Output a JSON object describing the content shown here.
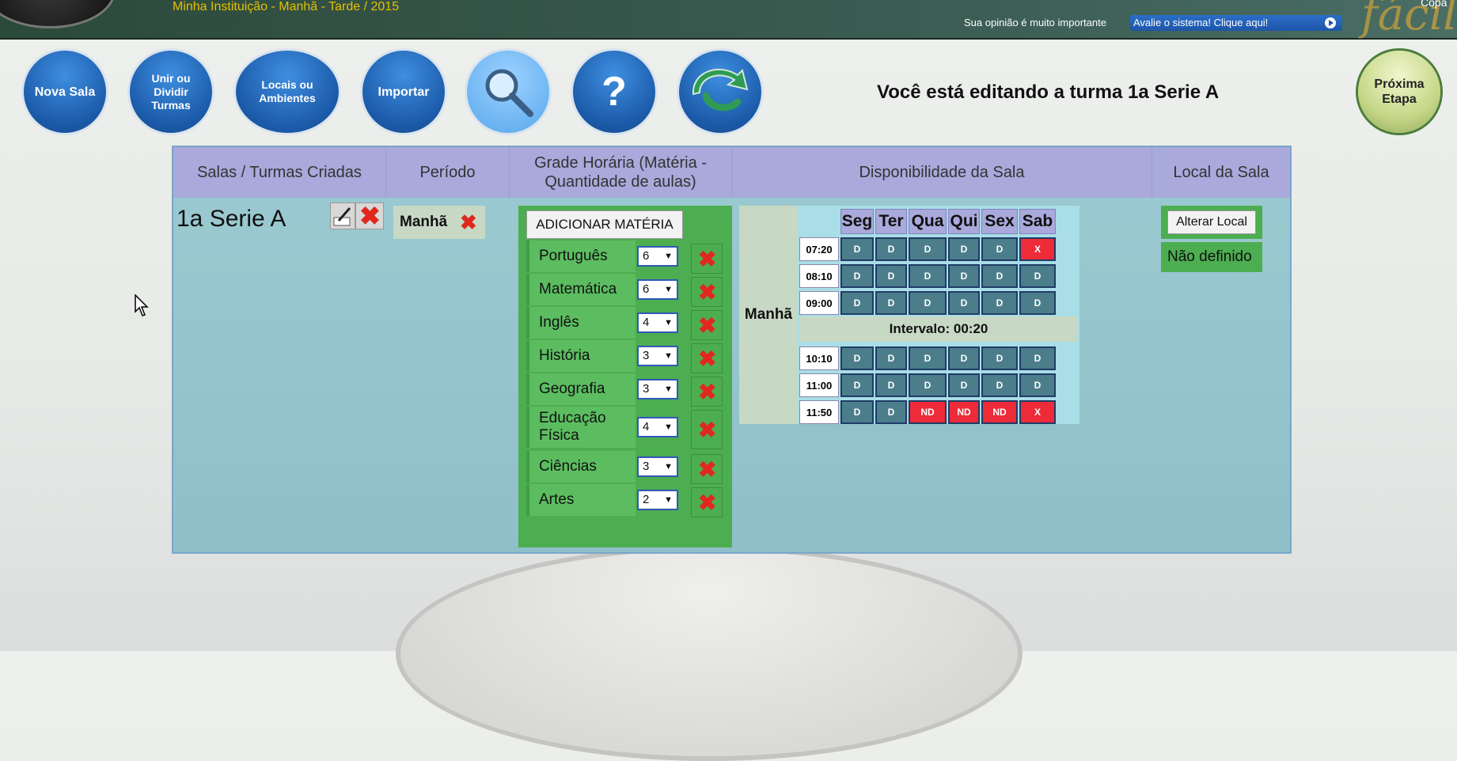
{
  "header": {
    "institution": "Minha Instituição - Manhã - Tarde / 2015",
    "opinion_text": "Sua opinião é muito importante",
    "evaluate_link": "Avalie o sistema! Clique aqui!",
    "brand": "fácil",
    "corner_text": "Copa"
  },
  "toolbar": {
    "nova_sala": "Nova Sala",
    "unir_dividir": "Unir ou Dividir Turmas",
    "locais": "Locais ou Ambientes",
    "importar": "Importar",
    "ajuda": "?",
    "proxima": "Próxima Etapa"
  },
  "editing_title": "Você está editando a turma 1a Serie A",
  "table": {
    "headers": {
      "salas": "Salas / Turmas Criadas",
      "periodo": "Período",
      "grade": "Grade Horária (Matéria - Quantidade de aulas)",
      "disponibilidade": "Disponibilidade da Sala",
      "local": "Local da Sala"
    },
    "turma_name": "1a Serie A",
    "periodo_value": "Manhã",
    "add_materia": "ADICIONAR MATÉRIA",
    "materias": [
      {
        "name": "Português",
        "qty": "6"
      },
      {
        "name": "Matemática",
        "qty": "6"
      },
      {
        "name": "Inglês",
        "qty": "4"
      },
      {
        "name": "História",
        "qty": "3"
      },
      {
        "name": "Geografia",
        "qty": "3"
      },
      {
        "name": "Educação Física",
        "qty": "4"
      },
      {
        "name": "Ciências",
        "qty": "3"
      },
      {
        "name": "Artes",
        "qty": "2"
      }
    ],
    "disponibilidade": {
      "period": "Manhã",
      "days": [
        "Seg",
        "Ter",
        "Qua",
        "Qui",
        "Sex",
        "Sab"
      ],
      "times": [
        "07:20",
        "08:10",
        "09:00",
        "10:10",
        "11:00",
        "11:50"
      ],
      "cells": [
        [
          "D",
          "D",
          "D",
          "D",
          "D",
          "X"
        ],
        [
          "D",
          "D",
          "D",
          "D",
          "D",
          "D"
        ],
        [
          "D",
          "D",
          "D",
          "D",
          "D",
          "D"
        ],
        [
          "D",
          "D",
          "D",
          "D",
          "D",
          "D"
        ],
        [
          "D",
          "D",
          "D",
          "D",
          "D",
          "D"
        ],
        [
          "D",
          "D",
          "ND",
          "ND",
          "ND",
          "X"
        ]
      ],
      "interval": "Intervalo: 00:20"
    },
    "alterar_local": "Alterar Local",
    "local_value": "Não definido"
  },
  "colors": {
    "available": "#4b7e8a",
    "unavailable": "#ee2b39",
    "header_bg": "#a9a9dc",
    "green": "#4cae50"
  }
}
